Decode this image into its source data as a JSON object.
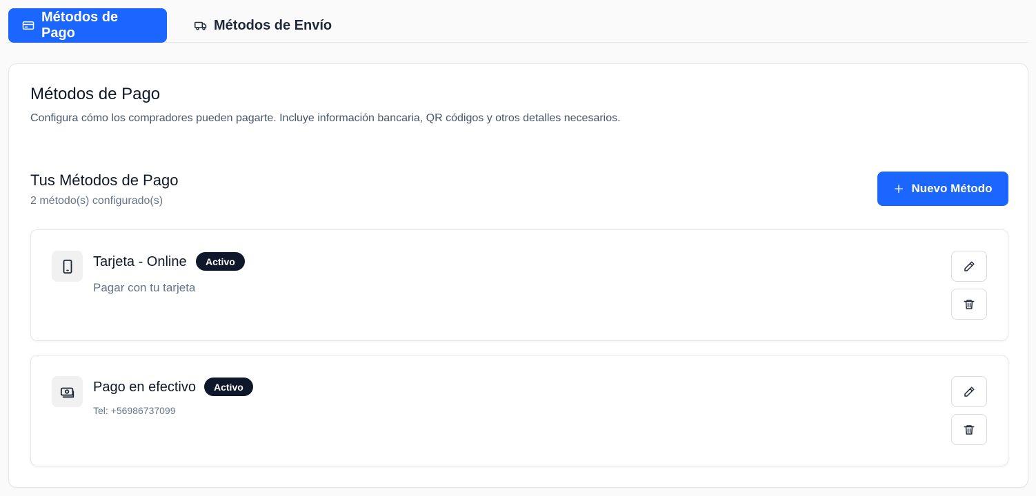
{
  "tabs": [
    {
      "label": "Métodos de Pago",
      "icon": "credit-card-icon",
      "active": true
    },
    {
      "label": "Métodos de Envío",
      "icon": "truck-icon",
      "active": false
    }
  ],
  "panel": {
    "title": "Métodos de Pago",
    "description": "Configura cómo los compradores pueden pagarte. Incluye información bancaria, QR códigos y otros detalles necesarios."
  },
  "section": {
    "title": "Tus Métodos de Pago",
    "count": "2 método(s) configurado(s)",
    "new_button": "Nuevo Método"
  },
  "methods": [
    {
      "name": "Tarjeta - Online",
      "badge": "Activo",
      "description": "Pagar con tu tarjeta",
      "icon": "smartphone-icon"
    },
    {
      "name": "Pago en efectivo",
      "badge": "Activo",
      "description": "Tel: +56986737099",
      "icon": "cash-icon"
    }
  ],
  "colors": {
    "accent": "#1b66ff",
    "badge_bg": "#0f172a"
  }
}
